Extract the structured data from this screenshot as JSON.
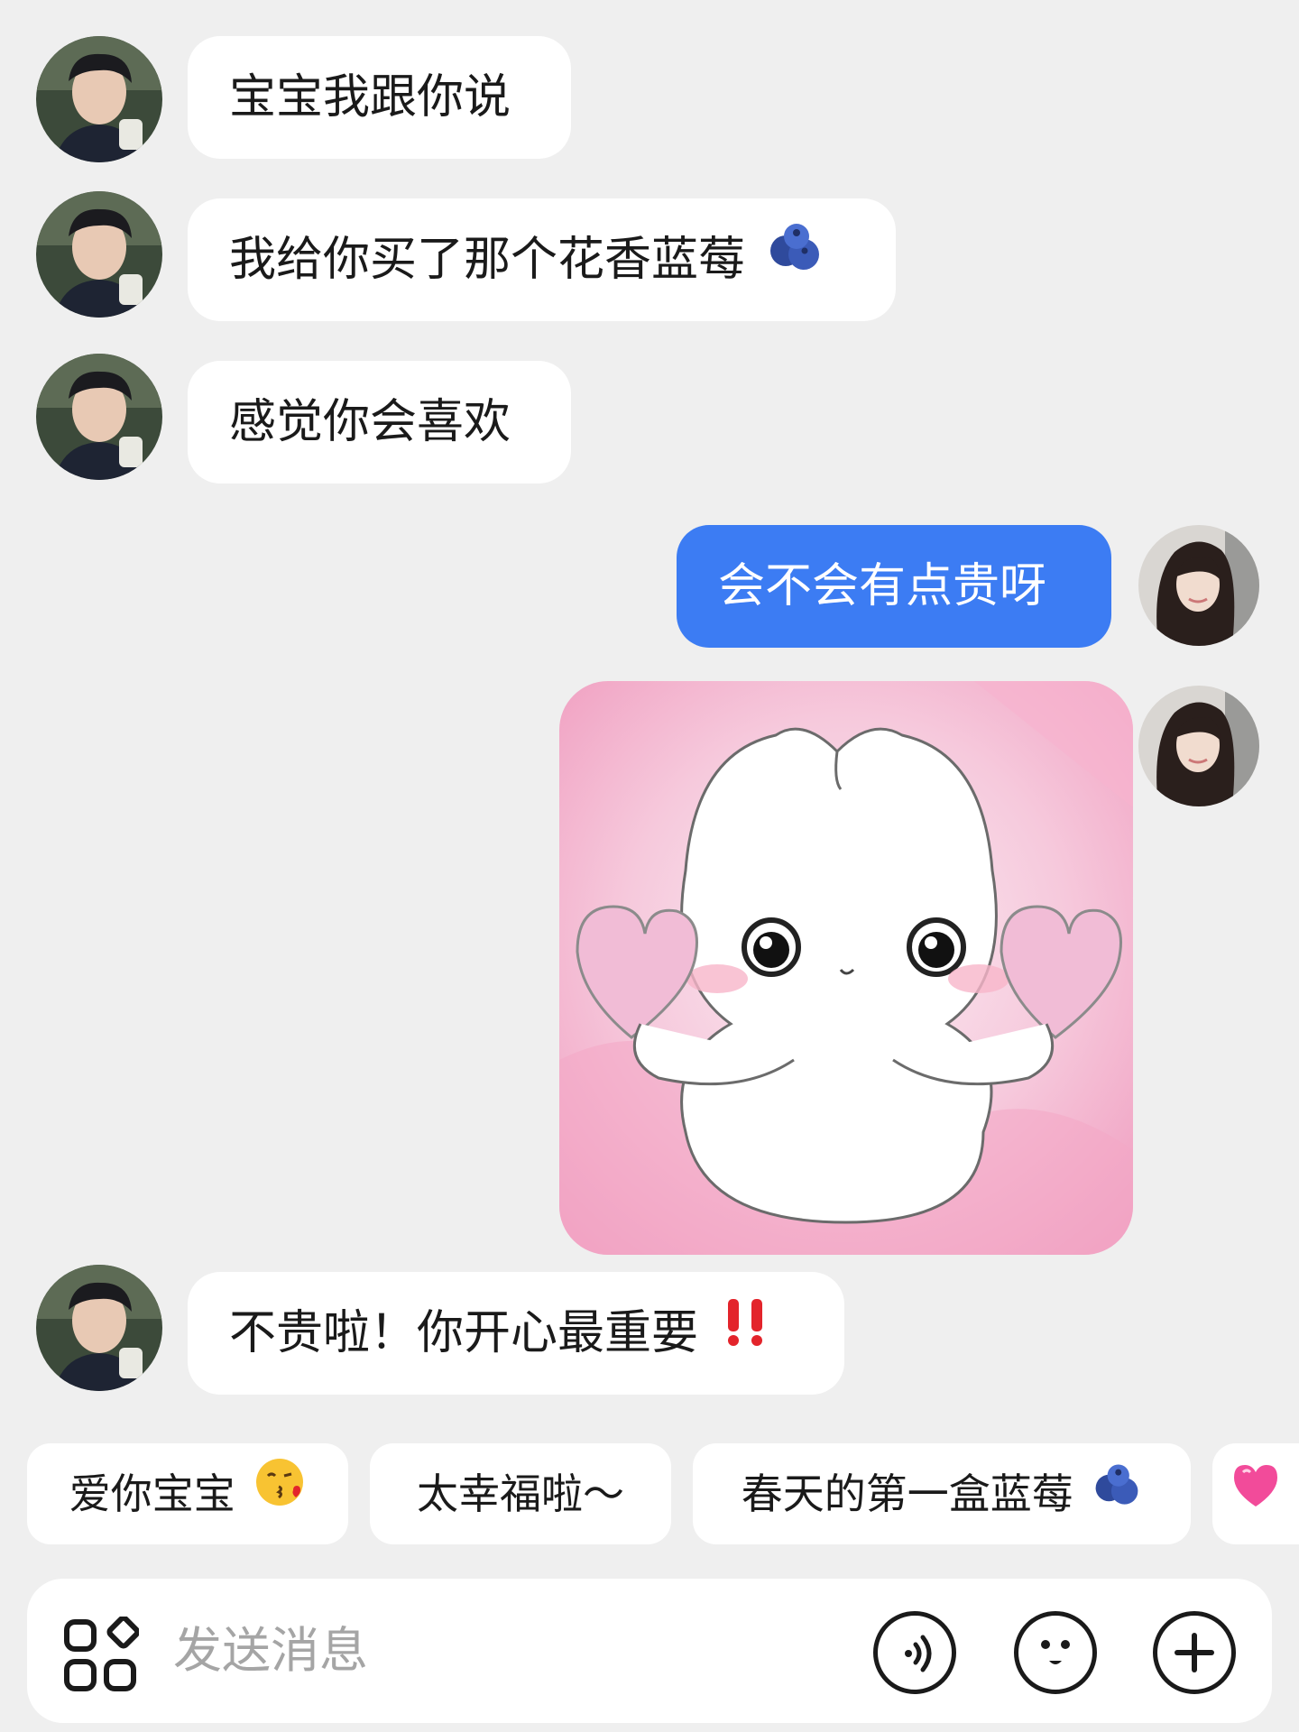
{
  "messages": [
    {
      "sender": "other",
      "type": "text",
      "text": "宝宝我跟你说"
    },
    {
      "sender": "other",
      "type": "text",
      "text": "我给你买了那个花香蓝莓",
      "emoji": "blueberry-icon"
    },
    {
      "sender": "other",
      "type": "text",
      "text": "感觉你会喜欢"
    },
    {
      "sender": "me",
      "type": "text",
      "text": "会不会有点贵呀"
    },
    {
      "sender": "me",
      "type": "sticker",
      "sticker": "white-bunny-with-hearts"
    },
    {
      "sender": "other",
      "type": "text",
      "text": "不贵啦！你开心最重要",
      "emoji": "double-exclamation-icon"
    }
  ],
  "quick_replies": [
    {
      "label": "爱你宝宝",
      "emoji": "kiss-face-icon"
    },
    {
      "label": "太幸福啦～",
      "emoji": ""
    },
    {
      "label": "春天的第一盒蓝莓",
      "emoji": "blueberry-icon"
    },
    {
      "label": "",
      "emoji": "pink-heart-icon"
    }
  ],
  "input": {
    "placeholder": "发送消息",
    "left_icon": "apps-grid-icon",
    "right_icons": [
      "voice-icon",
      "emoji-face-icon",
      "plus-icon"
    ]
  },
  "colors": {
    "background": "#efefef",
    "bubble_other": "#ffffff",
    "bubble_mine": "#3c7cf3",
    "text": "#1a1a1a",
    "placeholder": "#a5a5a5"
  }
}
